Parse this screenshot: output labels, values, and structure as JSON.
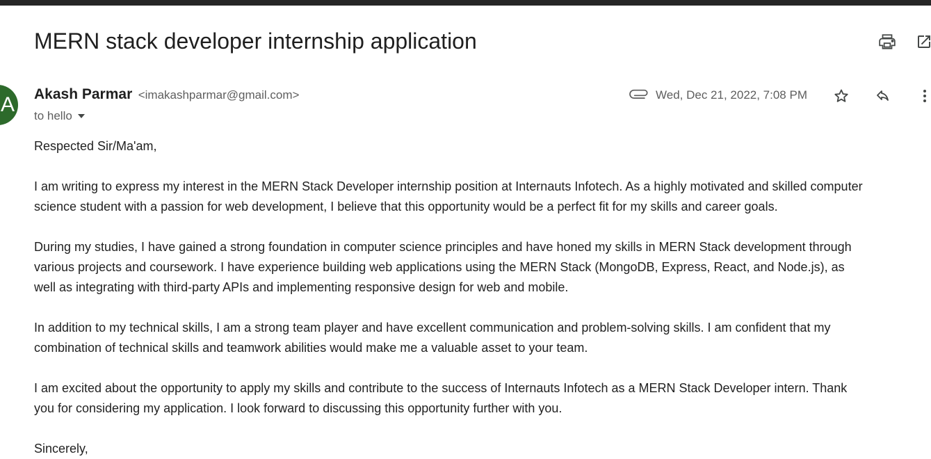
{
  "email": {
    "subject": "MERN stack developer internship application",
    "sender": {
      "avatar_letter": "A",
      "avatar_color": "#2d6a2b",
      "name": "Akash Parmar",
      "email": "<imakashparmar@gmail.com>",
      "to": "to hello"
    },
    "date": "Wed, Dec 21, 2022, 7:08 PM",
    "body": {
      "greeting": "Respected Sir/Ma'am,",
      "p1_l1": "I am writing to express my interest in the MERN Stack Developer internship position at Internauts Infotech. As a highly motivated and skilled computer",
      "p1_l2": "science student with a passion for web development, I believe that this opportunity would be a perfect fit for my skills and career goals.",
      "p2_l1": "During my studies, I have gained a strong foundation in computer science principles and have honed my skills in MERN Stack development through",
      "p2_l2": "various projects and coursework. I have experience building web applications using the MERN Stack (MongoDB, Express, React, and Node.js), as",
      "p2_l3": "well as integrating with third-party APIs and implementing responsive design for web and mobile.",
      "p3_l1": "In addition to my technical skills, I am a strong team player and have excellent communication and problem-solving skills. I am confident that my",
      "p3_l2": "combination of technical skills and teamwork abilities would make me a valuable asset to your team.",
      "p4_l1": "I am excited about the opportunity to apply my skills and contribute to the success of Internauts Infotech as a MERN Stack Developer intern. Thank",
      "p4_l2": "you for considering my application. I look forward to discussing this opportunity further with you.",
      "closing": "Sincerely,"
    }
  },
  "icons": {
    "print": "printer-icon",
    "popout": "open-in-new-window-icon",
    "attachment": "paperclip-icon",
    "star": "star-icon",
    "reply": "reply-icon",
    "more": "more-vertical-icon",
    "caret": "chevron-down-icon"
  }
}
